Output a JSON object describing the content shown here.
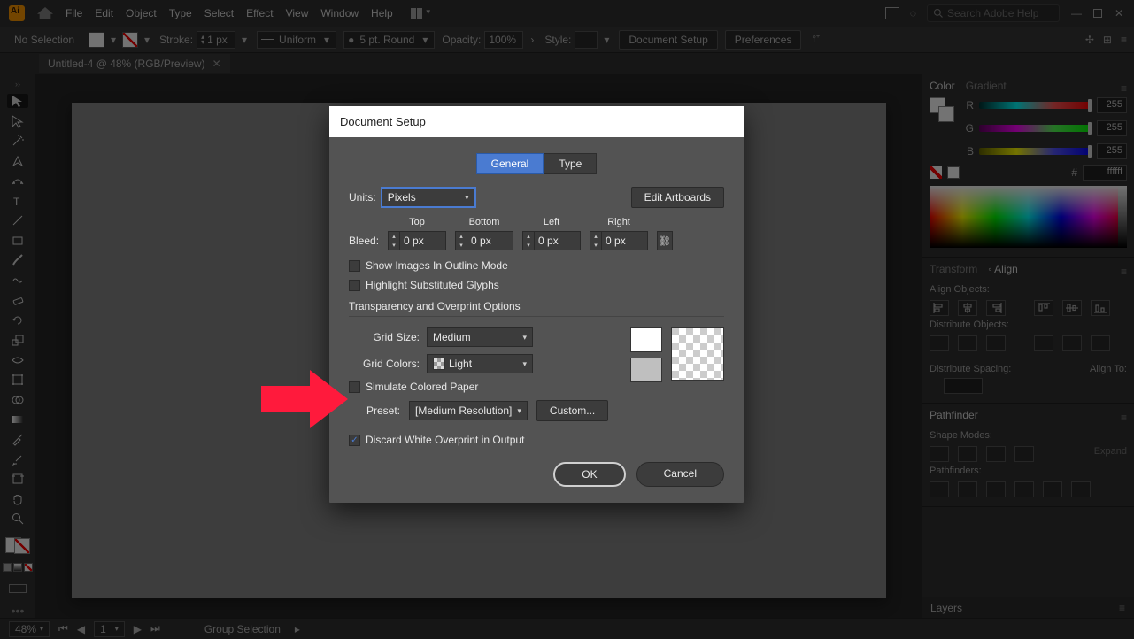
{
  "menubar": {
    "items": [
      "File",
      "Edit",
      "Object",
      "Type",
      "Select",
      "Effect",
      "View",
      "Window",
      "Help"
    ],
    "search_placeholder": "Search Adobe Help"
  },
  "control": {
    "selection": "No Selection",
    "stroke_label": "Stroke:",
    "stroke_value": "1 px",
    "profile": "Uniform",
    "brush": "5 pt. Round",
    "opacity_label": "Opacity:",
    "opacity_value": "100%",
    "style_label": "Style:",
    "doc_setup_btn": "Document Setup",
    "prefs_btn": "Preferences"
  },
  "doc_tab": "Untitled-4 @ 48% (RGB/Preview)",
  "statusbar": {
    "zoom": "48%",
    "nav": "1",
    "tool": "Group Selection"
  },
  "color_panel": {
    "tabs": [
      "Color",
      "Gradient"
    ],
    "channels": [
      {
        "l": "R",
        "v": "255"
      },
      {
        "l": "G",
        "v": "255"
      },
      {
        "l": "B",
        "v": "255"
      }
    ],
    "hex_prefix": "#",
    "hex": "ffffff"
  },
  "align_panel": {
    "tabs": [
      "Transform",
      "Align"
    ],
    "labels": {
      "align": "Align Objects:",
      "dist": "Distribute Objects:",
      "distsp": "Distribute Spacing:",
      "alignto": "Align To:"
    }
  },
  "pathfinder_panel": {
    "title": "Pathfinder",
    "shape_modes": "Shape Modes:",
    "expand": "Expand",
    "pathfinders": "Pathfinders:"
  },
  "layers_panel": {
    "title": "Layers"
  },
  "modal": {
    "title": "Document Setup",
    "tabs": [
      "General",
      "Type"
    ],
    "units_label": "Units:",
    "units_value": "Pixels",
    "edit_artboards": "Edit Artboards",
    "bleed_label": "Bleed:",
    "bleed": {
      "top": "Top",
      "bottom": "Bottom",
      "left": "Left",
      "right": "Right",
      "val": "0 px"
    },
    "chk_outline": "Show Images In Outline Mode",
    "chk_glyphs": "Highlight Substituted Glyphs",
    "section_trans": "Transparency and Overprint Options",
    "grid_size_label": "Grid Size:",
    "grid_size_value": "Medium",
    "grid_colors_label": "Grid Colors:",
    "grid_colors_value": "Light",
    "simulate": "Simulate Colored Paper",
    "preset_label": "Preset:",
    "preset_value": "[Medium Resolution]",
    "custom": "Custom...",
    "discard": "Discard White Overprint in Output",
    "ok": "OK",
    "cancel": "Cancel"
  }
}
